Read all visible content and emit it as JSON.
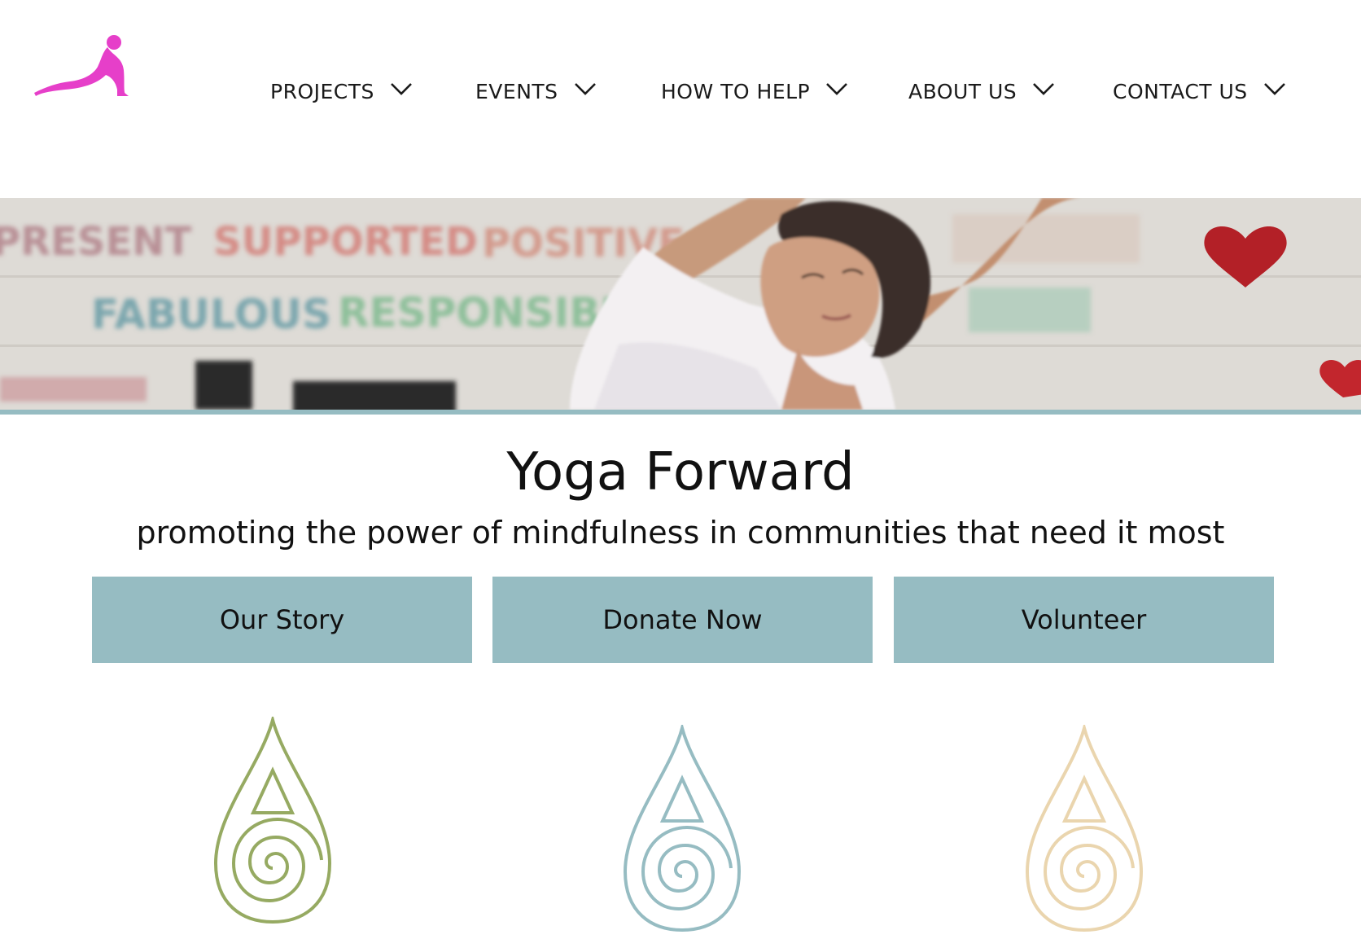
{
  "nav": {
    "items": [
      {
        "label": "PROJECTS"
      },
      {
        "label": "EVENTS"
      },
      {
        "label": "HOW TO HELP"
      },
      {
        "label": "ABOUT US"
      },
      {
        "label": "CONTACT US"
      }
    ]
  },
  "hero": {
    "wall_words": [
      "PRESENT",
      "SUPPORTED",
      "POSITIVE",
      "FABULOUS",
      "RESPONSIBLE"
    ],
    "heart_color": "#b32027"
  },
  "main": {
    "title": "Yoga Forward",
    "tagline": "promoting the power of mindfulness in communities that need it most",
    "buttons": [
      {
        "label": "Our Story"
      },
      {
        "label": "Donate Now"
      },
      {
        "label": "Volunteer"
      }
    ]
  },
  "colors": {
    "brand_pink": "#e63fc9",
    "button_bg": "#96bcc2",
    "drop_green": "#96aa62",
    "drop_blue": "#96bcc2",
    "drop_tan": "#ead5ae"
  }
}
